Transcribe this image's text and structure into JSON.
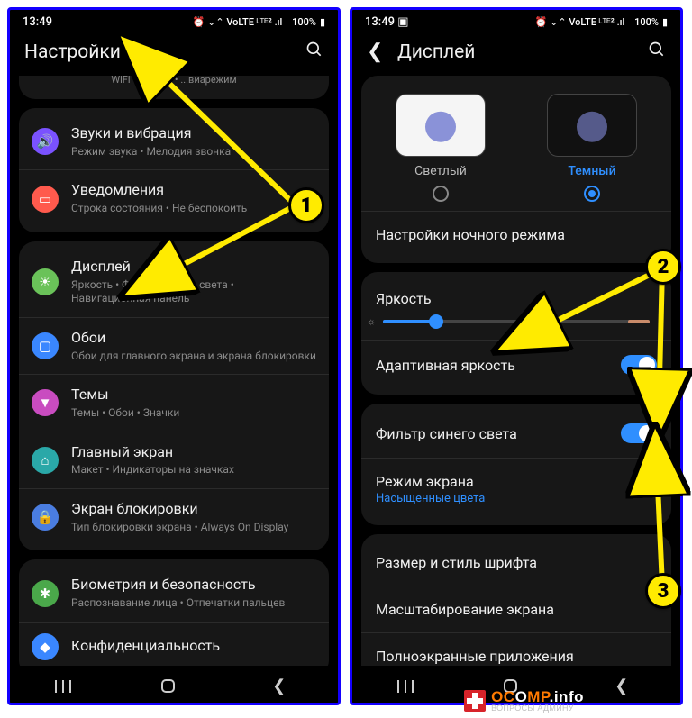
{
  "status": {
    "time": "13:49",
    "battery": "100%",
    "indicators": "⏰ ⌄⌃ VoLTE ᴸᵀᴱ² .ıl"
  },
  "left": {
    "title": "Настройки",
    "truncated": "WiFi   •   Bluetoo   •   ...виарежим",
    "items": [
      {
        "icon": "🔊",
        "cls": "ic-purple",
        "name": "sound",
        "title": "Звуки и вибрация",
        "sub": "Режим звука  •  Мелодия звонка"
      },
      {
        "icon": "▭",
        "cls": "ic-redor",
        "name": "notifications",
        "title": "Уведомления",
        "sub": "Строка состояния  •  Не беспокоить"
      }
    ],
    "items2": [
      {
        "icon": "☀",
        "cls": "ic-green",
        "name": "display",
        "title": "Дисплей",
        "sub": "Яркость  •  Фильтр синего света  •  Навигационная панель"
      },
      {
        "icon": "▢",
        "cls": "ic-blue",
        "name": "wallpaper",
        "title": "Обои",
        "sub": "Обои для главного экрана и экрана блокировки"
      },
      {
        "icon": "▼",
        "cls": "ic-pink",
        "name": "themes",
        "title": "Темы",
        "sub": "Темы  •  Обои  •  Значки"
      },
      {
        "icon": "⌂",
        "cls": "ic-teal",
        "name": "home",
        "title": "Главный экран",
        "sub": "Макет  •  Индикаторы на значках"
      },
      {
        "icon": "🔒",
        "cls": "ic-bluel",
        "name": "lock",
        "title": "Экран блокировки",
        "sub": "Тип блокировки экрана  •  Always On Display"
      }
    ],
    "items3": [
      {
        "icon": "✱",
        "cls": "ic-greenl",
        "name": "biometrics",
        "title": "Биометрия и безопасность",
        "sub": "Распознавание лица  •  Отпечатки пальцев"
      },
      {
        "icon": "◆",
        "cls": "ic-blue",
        "name": "privacy",
        "title": "Конфиденциальность",
        "sub": ""
      }
    ]
  },
  "right": {
    "title": "Дисплей",
    "themes": {
      "light": "Светлый",
      "dark": "Темный"
    },
    "night_mode": "Настройки ночного режима",
    "brightness": "Яркость",
    "adaptive": "Адаптивная яркость",
    "blue_filter": "Фильтр синего света",
    "screen_mode": "Режим экрана",
    "screen_mode_sub": "Насыщенные цвета",
    "font": "Размер и стиль шрифта",
    "zoom": "Масштабирование экрана",
    "fullscreen": "Полноэкранные приложения"
  },
  "annotations": {
    "b1": "1",
    "b2": "2",
    "b3": "3"
  },
  "watermark": {
    "main_a": "OC",
    "main_b": "O",
    "main_c": "MP",
    "main_d": ".info",
    "sub": "ВОПРОСЫ АДМИНУ"
  }
}
